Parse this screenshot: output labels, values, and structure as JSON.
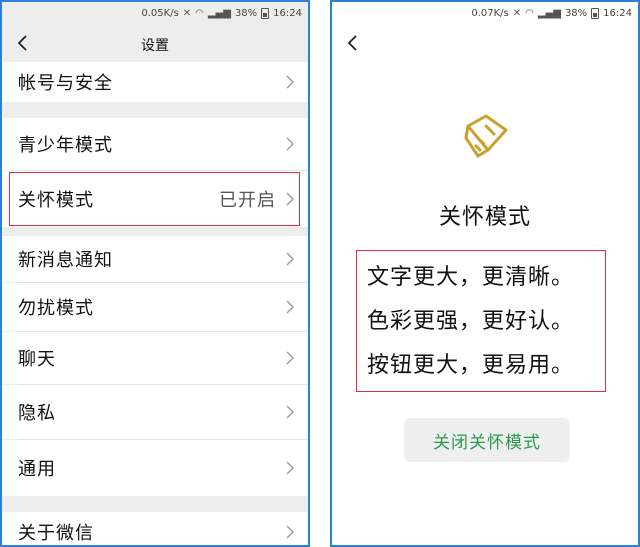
{
  "status_left": {
    "speed": "0.05K/s",
    "battery": "38%",
    "time": "16:24"
  },
  "status_right": {
    "speed": "0.07K/s",
    "battery": "38%",
    "time": "16:24"
  },
  "settings": {
    "title": "设置",
    "items": [
      {
        "label": "帐号与安全",
        "value": ""
      },
      {
        "label": "青少年模式",
        "value": ""
      },
      {
        "label": "关怀模式",
        "value": "已开启"
      },
      {
        "label": "新消息通知",
        "value": ""
      },
      {
        "label": "勿扰模式",
        "value": ""
      },
      {
        "label": "聊天",
        "value": ""
      },
      {
        "label": "隐私",
        "value": ""
      },
      {
        "label": "通用",
        "value": ""
      },
      {
        "label": "关于微信",
        "value": ""
      }
    ]
  },
  "care_mode": {
    "title": "关怀模式",
    "features": [
      "文字更大，更清晰。",
      "色彩更强，更好认。",
      "按钮更大，更易用。"
    ],
    "close_label": "关闭关怀模式"
  },
  "colors": {
    "frame": "#2f7fd4",
    "highlight": "#e2303b",
    "accent_green": "#2a9a4a",
    "logo_gold": "#c8a22e"
  }
}
